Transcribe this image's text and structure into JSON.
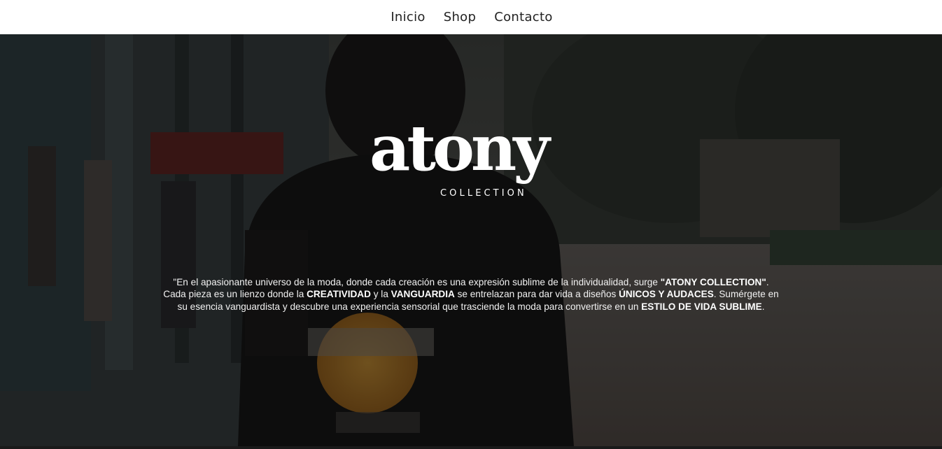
{
  "nav": {
    "items": [
      {
        "label": "Inicio"
      },
      {
        "label": "Shop"
      },
      {
        "label": "Contacto"
      }
    ]
  },
  "hero": {
    "background_image": "street-photo-hoodie",
    "logo": {
      "wordmark": "atony",
      "subtitle": "COLLECTION"
    },
    "tagline": [
      {
        "text": "\"En el apasionante universo de la moda, donde cada creación es una expresión sublime de la individualidad, surge ",
        "bold": false
      },
      {
        "text": "\"ATONY COLLECTION\"",
        "bold": true
      },
      {
        "text": ". Cada pieza es un lienzo donde la ",
        "bold": false
      },
      {
        "text": "CREATIVIDAD",
        "bold": true
      },
      {
        "text": " y la ",
        "bold": false
      },
      {
        "text": "VANGUARDIA",
        "bold": true
      },
      {
        "text": " se entrelazan para dar vida a diseños ",
        "bold": false
      },
      {
        "text": "ÚNICOS Y AUDACES",
        "bold": true
      },
      {
        "text": ". Sumérgete en su esencia vanguardista y descubre una experiencia sensorial que trasciende la moda para convertirse en un ",
        "bold": false
      },
      {
        "text": "ESTILO DE VIDA SUBLIME",
        "bold": true
      },
      {
        "text": ".",
        "bold": false
      }
    ]
  },
  "colors": {
    "nav_bg": "#ffffff",
    "nav_text": "#222222",
    "overlay": "#000000",
    "hero_text": "#ffffff"
  }
}
